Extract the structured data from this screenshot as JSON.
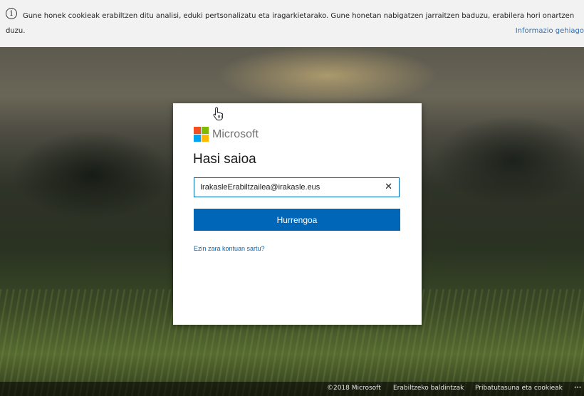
{
  "cookie_banner": {
    "info_glyph": "i",
    "message_line1": "Gune honek cookieak erabiltzen ditu analisi, eduki pertsonalizatu eta iragarkietarako. Gune honetan nabigatzen jarraitzen baduzu, erabilera hori onartzen",
    "message_line2": "duzu.",
    "more_info_link": "Informazio gehiago"
  },
  "signin": {
    "brand_name": "Microsoft",
    "title": "Hasi saioa",
    "email_value": "IrakasleErabiltzailea@irakasle.eus",
    "clear_glyph": "✕",
    "next_button": "Hurrengoa",
    "cant_access_link": "Ezin zara kontuan sartu?"
  },
  "footer": {
    "copyright": "©2018 Microsoft",
    "terms": "Erabiltzeko baldintzak",
    "privacy": "Pribatutasuna eta cookieak",
    "more": "···"
  },
  "colors": {
    "accent": "#0067b8",
    "logo_red": "#f25022",
    "logo_green": "#7fba00",
    "logo_blue": "#00a4ef",
    "logo_yellow": "#ffb900"
  },
  "icons": [
    "info-icon",
    "microsoft-logo",
    "hand-pointer-cursor-icon",
    "clear-icon"
  ]
}
